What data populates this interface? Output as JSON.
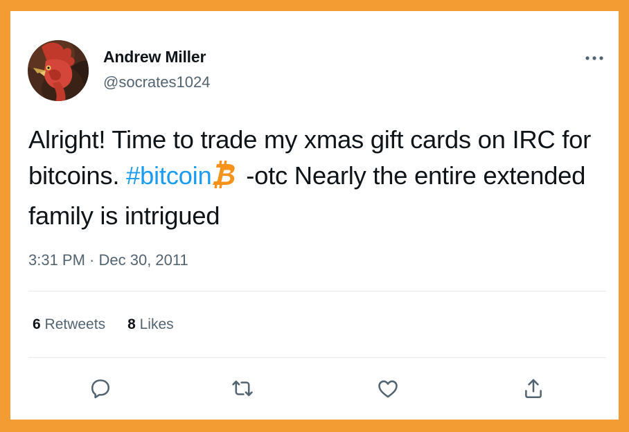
{
  "author": {
    "display_name": "Andrew Miller",
    "handle": "@socrates1024",
    "avatar_icon": "rooster-avatar"
  },
  "tweet": {
    "text_before": "Alright! Time to trade my xmas gift cards on IRC for bitcoins. ",
    "hashtag": "#bitcoin",
    "hashtag_icon": "bitcoin-logo-icon",
    "text_after": " -otc Nearly the entire extended family is intrigued"
  },
  "timestamp": "3:31 PM · Dec 30, 2011",
  "stats": {
    "retweets_count": "6",
    "retweets_label": "Retweets",
    "likes_count": "8",
    "likes_label": "Likes"
  },
  "actions": [
    "reply-icon",
    "retweet-icon",
    "like-icon",
    "share-icon"
  ],
  "colors": {
    "border": "#f39c33",
    "link": "#1d9bf0",
    "secondary_text": "#536471",
    "primary_text": "#0f1419",
    "bitcoin": "#f7931a"
  }
}
